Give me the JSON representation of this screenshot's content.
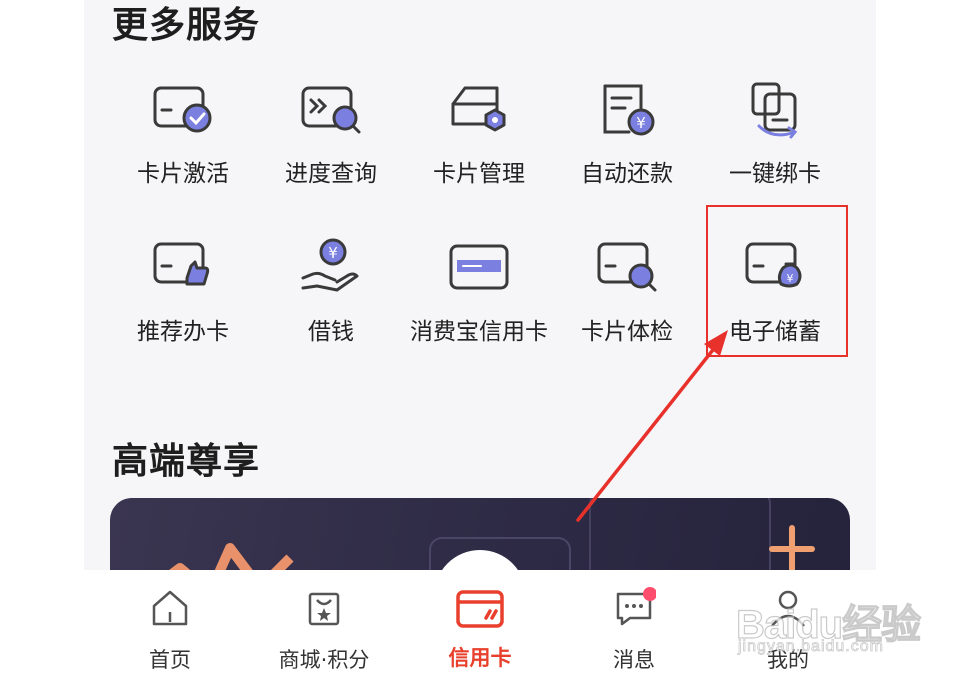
{
  "sections": {
    "more_services": "更多服务",
    "premium": "高端尊享"
  },
  "services": [
    {
      "label": "卡片激活",
      "icon": "card-activate-icon"
    },
    {
      "label": "进度查询",
      "icon": "progress-search-icon"
    },
    {
      "label": "卡片管理",
      "icon": "card-manage-icon"
    },
    {
      "label": "自动还款",
      "icon": "auto-repay-icon"
    },
    {
      "label": "一键绑卡",
      "icon": "bind-card-icon"
    },
    {
      "label": "推荐办卡",
      "icon": "recommend-card-icon"
    },
    {
      "label": "借钱",
      "icon": "borrow-money-icon"
    },
    {
      "label": "消费宝信用卡",
      "icon": "credit-card-icon"
    },
    {
      "label": "卡片体检",
      "icon": "card-checkup-icon"
    },
    {
      "label": "电子储蓄",
      "icon": "e-savings-icon"
    }
  ],
  "tabbar": [
    {
      "label": "首页",
      "icon": "home-icon"
    },
    {
      "label": "商城·积分",
      "icon": "shopping-bag-icon"
    },
    {
      "label": "信用卡",
      "icon": "credit-card-tab-icon",
      "active": true
    },
    {
      "label": "消息",
      "icon": "message-icon",
      "badge": true
    },
    {
      "label": "我的",
      "icon": "profile-icon"
    }
  ],
  "watermark": {
    "main": "Baidu经验",
    "sub": "jingyan.baidu.com"
  },
  "colors": {
    "accent_purple": "#7a7fe0",
    "active_red": "#e8402c",
    "highlight_red": "#e8312b",
    "badge_pink": "#ff4d6d",
    "banner_dark": "#2d2a45"
  }
}
